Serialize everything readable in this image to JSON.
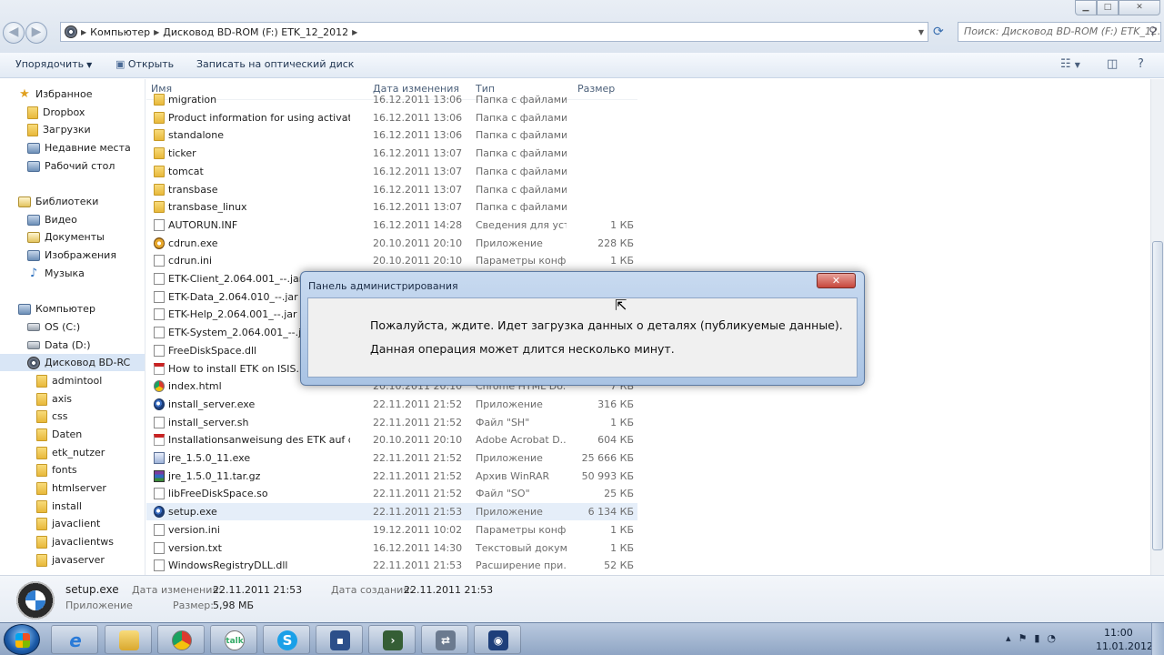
{
  "address": {
    "crumbs": [
      "Компьютер",
      "Дисковод BD-ROM (F:) ETK_12_2012"
    ],
    "search_placeholder": "Поиск: Дисковод BD-ROM (F:) ETK_12..."
  },
  "toolbar": {
    "organize": "Упорядочить",
    "open": "Открыть",
    "burn": "Записать на оптический диск"
  },
  "sidebar": {
    "favorites": {
      "label": "Избранное",
      "items": [
        "Dropbox",
        "Загрузки",
        "Недавние места",
        "Рабочий стол"
      ]
    },
    "libraries": {
      "label": "Библиотеки",
      "items": [
        "Видео",
        "Документы",
        "Изображения",
        "Музыка"
      ]
    },
    "computer": {
      "label": "Компьютер",
      "drives": [
        "OS (C:)",
        "Data (D:)",
        "Дисковод BD-RC"
      ]
    },
    "folders": [
      "admintool",
      "axis",
      "css",
      "Daten",
      "etk_nutzer",
      "fonts",
      "htmlserver",
      "install",
      "javaclient",
      "javaclientws",
      "javaserver"
    ]
  },
  "columns": {
    "name": "Имя",
    "date": "Дата изменения",
    "type": "Тип",
    "size": "Размер"
  },
  "files": [
    {
      "name": "migration",
      "date": "16.12.2011 13:06",
      "type": "Папка с файлами",
      "size": "",
      "icon": "folder-icon"
    },
    {
      "name": "Product information for using activation ...",
      "date": "16.12.2011 13:06",
      "type": "Папка с файлами",
      "size": "",
      "icon": "folder-icon"
    },
    {
      "name": "standalone",
      "date": "16.12.2011 13:06",
      "type": "Папка с файлами",
      "size": "",
      "icon": "folder-icon"
    },
    {
      "name": "ticker",
      "date": "16.12.2011 13:07",
      "type": "Папка с файлами",
      "size": "",
      "icon": "folder-icon"
    },
    {
      "name": "tomcat",
      "date": "16.12.2011 13:07",
      "type": "Папка с файлами",
      "size": "",
      "icon": "folder-icon"
    },
    {
      "name": "transbase",
      "date": "16.12.2011 13:07",
      "type": "Папка с файлами",
      "size": "",
      "icon": "folder-icon"
    },
    {
      "name": "transbase_linux",
      "date": "16.12.2011 13:07",
      "type": "Папка с файлами",
      "size": "",
      "icon": "folder-icon"
    },
    {
      "name": "AUTORUN.INF",
      "date": "16.12.2011 14:28",
      "type": "Сведения для уст...",
      "size": "1 КБ",
      "icon": "file-icon"
    },
    {
      "name": "cdrun.exe",
      "date": "20.10.2011 20:10",
      "type": "Приложение",
      "size": "228 КБ",
      "icon": "cdrun-app-icon"
    },
    {
      "name": "cdrun.ini",
      "date": "20.10.2011 20:10",
      "type": "Параметры конф...",
      "size": "1 КБ",
      "icon": "file-icon"
    },
    {
      "name": "ETK-Client_2.064.001_--.jar",
      "date": "",
      "type": "",
      "size": "",
      "icon": "file-icon"
    },
    {
      "name": "ETK-Data_2.064.010_--.jar",
      "date": "",
      "type": "",
      "size": "",
      "icon": "file-icon"
    },
    {
      "name": "ETK-Help_2.064.001_--.jar",
      "date": "",
      "type": "",
      "size": "",
      "icon": "file-icon"
    },
    {
      "name": "ETK-System_2.064.001_--.jar",
      "date": "",
      "type": "",
      "size": "",
      "icon": "file-icon"
    },
    {
      "name": "FreeDiskSpace.dll",
      "date": "",
      "type": "",
      "size": "",
      "icon": "file-icon"
    },
    {
      "name": "How to install ETK on ISIS.pdf",
      "date": "",
      "type": "",
      "size": "",
      "icon": "pdf-icon"
    },
    {
      "name": "index.html",
      "date": "20.10.2011 20:10",
      "type": "Chrome HTML Do...",
      "size": "7 КБ",
      "icon": "chrome-icon"
    },
    {
      "name": "install_server.exe",
      "date": "22.11.2011 21:52",
      "type": "Приложение",
      "size": "316 КБ",
      "icon": "setup-globe-icon"
    },
    {
      "name": "install_server.sh",
      "date": "22.11.2011 21:52",
      "type": "Файл \"SH\"",
      "size": "1 КБ",
      "icon": "file-icon"
    },
    {
      "name": "Installationsanweisung des ETK auf der IS...",
      "date": "20.10.2011 20:10",
      "type": "Adobe Acrobat D...",
      "size": "604 КБ",
      "icon": "pdf-icon"
    },
    {
      "name": "jre_1.5.0_11.exe",
      "date": "22.11.2011 21:52",
      "type": "Приложение",
      "size": "25 666 КБ",
      "icon": "exe-icon"
    },
    {
      "name": "jre_1.5.0_11.tar.gz",
      "date": "22.11.2011 21:52",
      "type": "Архив WinRAR",
      "size": "50 993 КБ",
      "icon": "winrar-icon"
    },
    {
      "name": "libFreeDiskSpace.so",
      "date": "22.11.2011 21:52",
      "type": "Файл \"SO\"",
      "size": "25 КБ",
      "icon": "file-icon"
    },
    {
      "name": "setup.exe",
      "date": "22.11.2011 21:53",
      "type": "Приложение",
      "size": "6 134 КБ",
      "icon": "setup-globe-icon"
    },
    {
      "name": "version.ini",
      "date": "19.12.2011 10:02",
      "type": "Параметры конф...",
      "size": "1 КБ",
      "icon": "file-icon"
    },
    {
      "name": "version.txt",
      "date": "16.12.2011 14:30",
      "type": "Текстовый докум...",
      "size": "1 КБ",
      "icon": "file-icon"
    },
    {
      "name": "WindowsRegistryDLL.dll",
      "date": "22.11.2011 21:53",
      "type": "Расширение при...",
      "size": "52 КБ",
      "icon": "file-icon"
    }
  ],
  "selected_file_index": 23,
  "details": {
    "name": "setup.exe",
    "type": "Приложение",
    "modified_label": "Дата изменения:",
    "modified": "22.11.2011 21:53",
    "created_label": "Дата создания:",
    "created": "22.11.2011 21:53",
    "size_label": "Размер:",
    "size": "5,98 МБ"
  },
  "dialog": {
    "title": "Панель администрирования",
    "line1": "Пожалуйста, ждите. Идет загрузка данных о деталях (публикуемые данные).",
    "line2": "Данная операция может длится несколько минут."
  },
  "taskbar": {
    "apps": [
      "internet-explorer",
      "file-explorer",
      "chrome",
      "google-talk",
      "skype",
      "save-disk",
      "terminal",
      "network",
      "etk-app"
    ],
    "time": "11:00",
    "date": "11.01.2012"
  },
  "colors": {
    "selection": "#d9e6f6",
    "dialog_frame": "#a9c3e4",
    "close_red": "#c7463b"
  }
}
